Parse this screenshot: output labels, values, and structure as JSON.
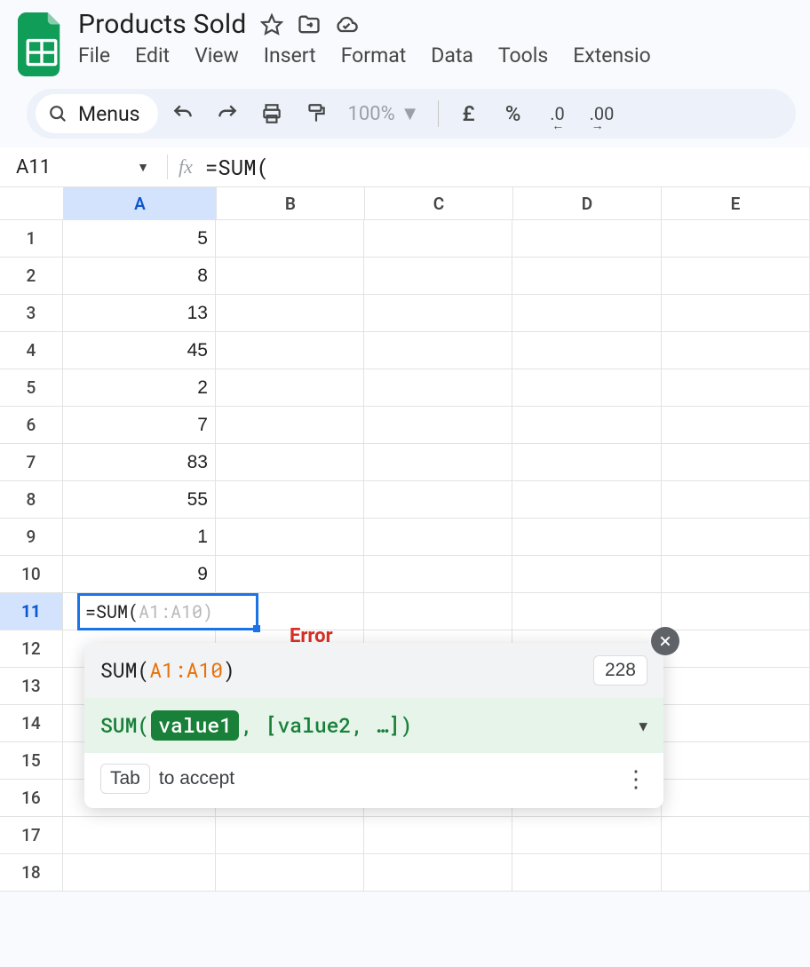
{
  "header": {
    "title": "Products Sold",
    "menus": [
      "File",
      "Edit",
      "View",
      "Insert",
      "Format",
      "Data",
      "Tools",
      "Extensio"
    ]
  },
  "toolbar": {
    "menus_chip": "Menus",
    "zoom": "100%",
    "currency": "£",
    "percent": "%",
    "dec_decrease": ".0",
    "dec_increase": ".00"
  },
  "namebox": {
    "cell_ref": "A11",
    "fx": "fx",
    "formula": "=SUM("
  },
  "columns": [
    "A",
    "B",
    "C",
    "D",
    "E"
  ],
  "selected_column_index": 0,
  "selected_row_index": 10,
  "rows": [
    {
      "num": "1",
      "A": "5"
    },
    {
      "num": "2",
      "A": "8"
    },
    {
      "num": "3",
      "A": "13"
    },
    {
      "num": "4",
      "A": "45"
    },
    {
      "num": "5",
      "A": "2"
    },
    {
      "num": "6",
      "A": "7"
    },
    {
      "num": "7",
      "A": "83"
    },
    {
      "num": "8",
      "A": "55"
    },
    {
      "num": "9",
      "A": "1"
    },
    {
      "num": "10",
      "A": "9"
    },
    {
      "num": "11",
      "A": ""
    },
    {
      "num": "12",
      "A": ""
    },
    {
      "num": "13",
      "A": ""
    },
    {
      "num": "14",
      "A": ""
    },
    {
      "num": "15",
      "A": ""
    },
    {
      "num": "16",
      "A": ""
    },
    {
      "num": "17",
      "A": ""
    },
    {
      "num": "18",
      "A": ""
    }
  ],
  "editing": {
    "typed": "=SUM(",
    "ghost": "A1:A10)"
  },
  "error_label": "Error",
  "popup": {
    "suggestion_prefix": "SUM(",
    "suggestion_range": "A1:A10",
    "suggestion_suffix": ")",
    "suggestion_result": "228",
    "signature_fn": "SUM(",
    "signature_arg1": "value1",
    "signature_rest": ", [value2, …])",
    "hint_chip": "Tab",
    "hint_text": "to accept"
  }
}
